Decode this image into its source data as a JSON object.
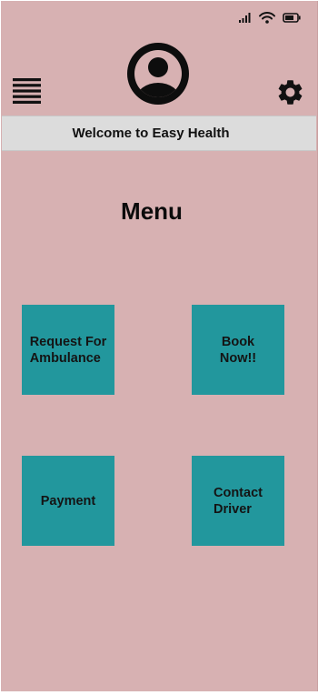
{
  "header": {
    "welcome_text": "Welcome to Easy Health"
  },
  "main": {
    "title": "Menu",
    "tiles": [
      {
        "label": "Request For\nAmbulance"
      },
      {
        "label": "Book\nNow!!"
      },
      {
        "label": "Payment"
      },
      {
        "label": "Contact\nDriver"
      }
    ]
  },
  "icons": {
    "menu": "hamburger-menu-icon",
    "avatar": "user-avatar-icon",
    "settings": "gear-icon",
    "signal": "signal-icon",
    "wifi": "wifi-icon",
    "battery": "battery-icon"
  },
  "colors": {
    "background": "#d7b1b2",
    "welcome_bar": "#dcdcdc",
    "tile": "#22979d",
    "text": "#111111"
  }
}
